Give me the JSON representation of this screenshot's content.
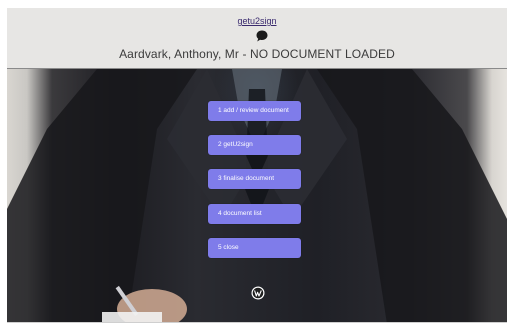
{
  "header": {
    "brand_link": "getu2sign",
    "brand_icon": "speech-bubble-icon",
    "status_title": "Aardvark, Anthony, Mr - NO DOCUMENT LOADED"
  },
  "menu": {
    "items": [
      {
        "label": "1   add / review document"
      },
      {
        "label": "2   getU2sign"
      },
      {
        "label": "3   finalise document"
      },
      {
        "label": "4   document list"
      },
      {
        "label": "5   close"
      }
    ]
  },
  "footer": {
    "logo_icon": "wordpress-icon"
  },
  "colors": {
    "button": "#7f7cea",
    "header_bg": "#e7e6e4",
    "brand_link": "#3a2a6e"
  }
}
